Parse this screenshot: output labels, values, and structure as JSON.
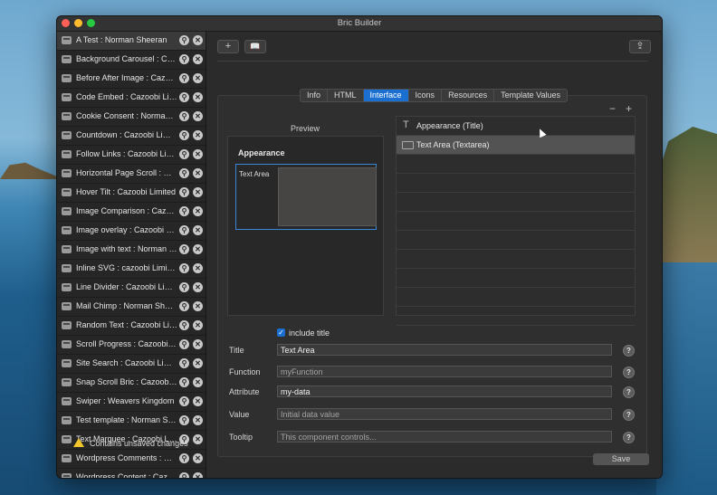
{
  "window": {
    "title": "Bric Builder"
  },
  "sidebar": {
    "items": [
      "A Test : Norman  Sheeran",
      "Background Carousel : Cazoobi Limited",
      "Before After Image : Cazoobi Limited",
      "Code Embed : Cazoobi Limited",
      "Cookie Consent : Norman Sheeran",
      "Countdown : Cazoobi Limited",
      "Follow Links : Cazoobi Limited",
      "Horizontal Page Scroll : Cazoobi Limited",
      "Hover Tilt : Cazoobi Limited",
      "Image Comparison : Cazoobi Limited",
      "Image overlay : Cazoobi Limited",
      "Image with text : Norman Sheeran",
      "Inline SVG : cazoobi Limited",
      "Line Divider : Cazoobi Limited",
      "Mail Chimp : Norman  Sheeran",
      "Random Text : Cazoobi Limited",
      "Scroll Progress : Cazoobi Limited",
      "Site Search : Cazoobi Limited",
      "Snap Scroll Bric : Cazoobi Limited",
      "Swiper : Weavers Kingdom",
      "Test template : Norman  Sheeran",
      "Text Marquee : Cazoobi Limited",
      "Wordpress Comments : Cazoobi Limited",
      "Wordpress Content : Cazoobi Limited"
    ]
  },
  "toolbar": {
    "add_label": "+",
    "book_label": "📖",
    "share_label": "⇪"
  },
  "tabs": [
    "Info",
    "HTML",
    "Interface",
    "Icons",
    "Resources",
    "Template Values"
  ],
  "active_tab": "Interface",
  "panel": {
    "minus": "−",
    "plus": "+"
  },
  "preview": {
    "title": "Preview",
    "heading": "Appearance",
    "component_label": "Text Area"
  },
  "components": [
    {
      "label": "Appearance (Title)",
      "icon": "title-icon"
    },
    {
      "label": "Text Area (Textarea)",
      "icon": "textarea-icon"
    }
  ],
  "form": {
    "include_title": "include title",
    "title_label": "Title",
    "title_value": "Text Area",
    "function_label": "Function",
    "function_placeholder": "myFunction",
    "attribute_label": "Attribute",
    "attribute_value": "my-data",
    "value_label": "Value",
    "value_placeholder": "Initial data value",
    "tooltip_label": "Tooltip",
    "tooltip_placeholder": "This component controls...",
    "help": "?"
  },
  "footer": {
    "warning": "Contains unsaved changes",
    "save_label": "Save"
  },
  "colors": {
    "accent": "#1a6fd1",
    "warning": "#f0c42a"
  }
}
